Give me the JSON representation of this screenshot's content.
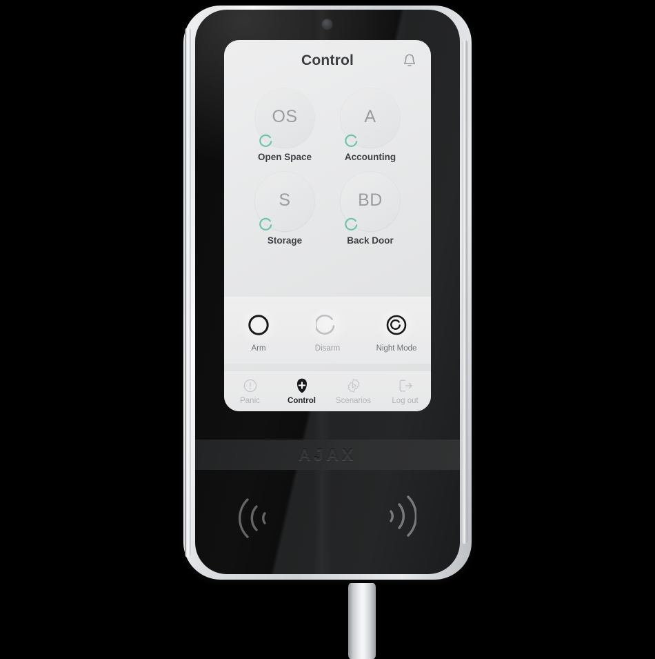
{
  "device": {
    "brand": "AJAX",
    "sensor_icon": "proximity-sensor-dot"
  },
  "screen": {
    "header": {
      "title": "Control",
      "bell_icon": "bell-icon"
    },
    "groups": [
      {
        "abbr": "OS",
        "label": "Open Space",
        "status_icon": "arc-progress-icon",
        "status_color": "#6ec4a8"
      },
      {
        "abbr": "A",
        "label": "Accounting",
        "status_icon": "arc-progress-icon",
        "status_color": "#6ec4a8"
      },
      {
        "abbr": "S",
        "label": "Storage",
        "status_icon": "arc-progress-icon",
        "status_color": "#6ec4a8"
      },
      {
        "abbr": "BD",
        "label": "Back Door",
        "status_icon": "arc-progress-icon",
        "status_color": "#6ec4a8"
      }
    ],
    "actions": [
      {
        "label": "Arm",
        "icon": "arm-circle-icon",
        "state": "enabled"
      },
      {
        "label": "Disarm",
        "icon": "disarm-open-circle-icon",
        "state": "disabled"
      },
      {
        "label": "Night Mode",
        "icon": "night-mode-icon",
        "state": "enabled"
      }
    ],
    "nav": [
      {
        "label": "Panic",
        "icon": "alert-circle-icon",
        "active": false
      },
      {
        "label": "Control",
        "icon": "shield-plus-icon",
        "active": true
      },
      {
        "label": "Scenarios",
        "icon": "gear-play-icon",
        "active": false
      },
      {
        "label": "Log out",
        "icon": "exit-arrow-icon",
        "active": false
      }
    ]
  },
  "reader": {
    "left_icon": "rfid-wave-left-icon",
    "right_icon": "rfid-wave-right-icon"
  },
  "colors": {
    "accent_green": "#6ec4a8",
    "screen_bg": "#e9eaeb",
    "text_primary": "#3b3d40",
    "text_muted": "#9b9ea1",
    "bezel": "#101010"
  }
}
